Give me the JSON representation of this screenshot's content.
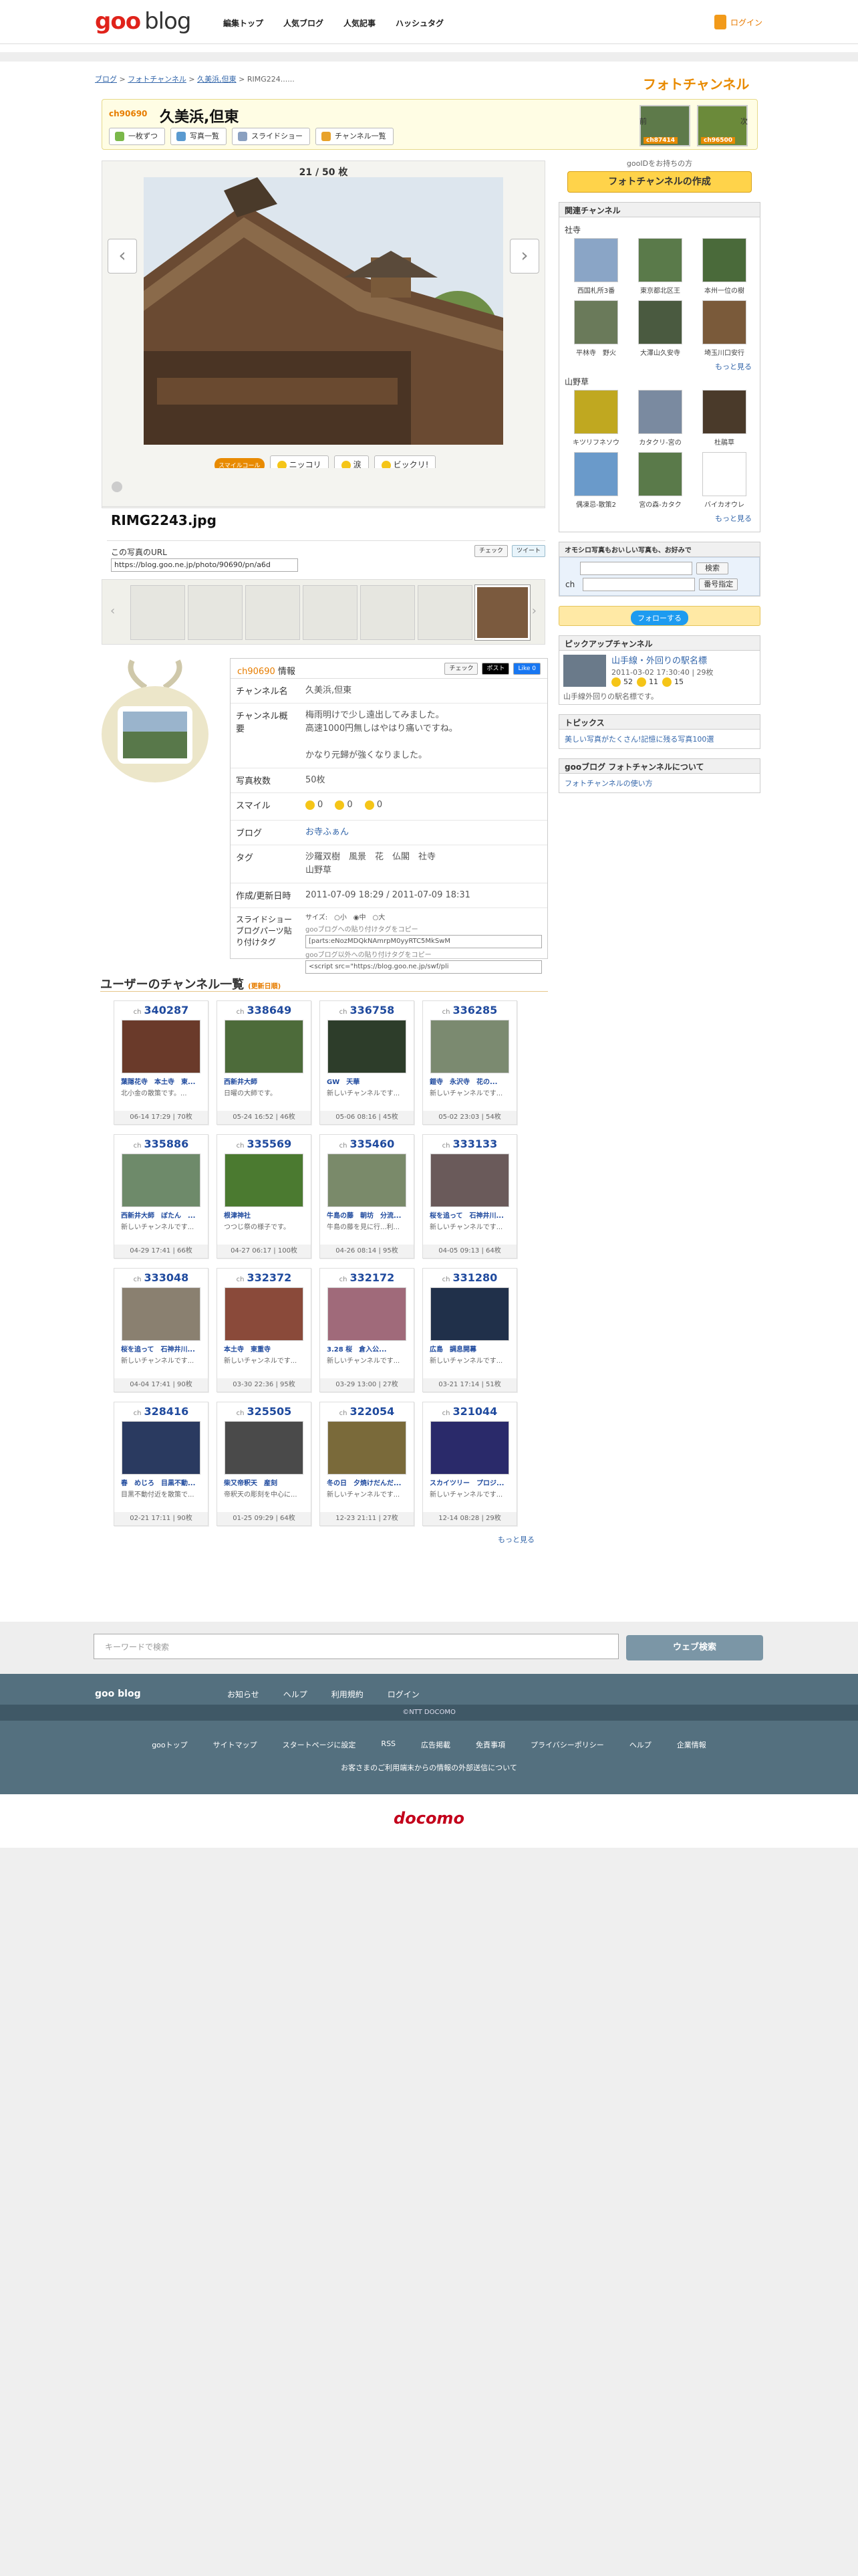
{
  "header": {
    "logo_goo": "goo",
    "logo_blog": "blog",
    "nav": [
      "編集トップ",
      "人気ブログ",
      "人気記事",
      "ハッシュタグ"
    ],
    "login": "ログイン"
  },
  "breadcrumb": [
    "ブログ",
    "フォトチャンネル",
    "久美浜,但東",
    "RIMG224......"
  ],
  "photochannel_logo": "フォトチャンネル",
  "channel": {
    "id": "ch90690",
    "title": "久美浜,但東",
    "buttons": [
      "一枚ずつ",
      "写真一覧",
      "スライドショー",
      "チャンネル一覧"
    ],
    "prev_label": "前",
    "next_label": "次",
    "prev_id": "ch87414",
    "next_id": "ch96500"
  },
  "viewer": {
    "counter": "21 / 50 枚",
    "reactions": [
      "ニッコリ",
      "涙",
      "ビックリ!"
    ],
    "reaction_tag": "スマイルコール",
    "filename": "RIMG2243.jpg",
    "url_label": "この写真のURL",
    "url_value": "https://blog.goo.ne.jp/photo/90690/pn/a6d",
    "check": "チェック",
    "tweet": "ツイート"
  },
  "info": {
    "header": "ch90690 情報",
    "header_id": "ch90690",
    "header_suffix": "情報",
    "post": "ポスト",
    "like": "Like 0",
    "rows": [
      {
        "k": "チャンネル名",
        "v": "久美浜,但東"
      },
      {
        "k": "チャンネル概要",
        "v": "梅雨明けで少し遠出してみました。\n高速1000円無しはやはり痛いですね。\n\nかなり元歸が強くなりました。"
      },
      {
        "k": "写真枚数",
        "v": "50枚"
      },
      {
        "k": "スマイル",
        "v": ""
      },
      {
        "k": "ブログ",
        "v": "お寺ふぁん"
      },
      {
        "k": "タグ",
        "v": "沙羅双樹　風景　花　仏閣　社寺\n山野草"
      },
      {
        "k": "作成/更新日時",
        "v": "2011-07-09 18:29 / 2011-07-09 18:31"
      },
      {
        "k": "スライドショーブログパーツ貼り付けタグ",
        "v": ""
      }
    ],
    "smiles": [
      "0",
      "0",
      "0"
    ],
    "size_label": "サイズ",
    "sizes": [
      "小",
      "中",
      "大"
    ],
    "tag_label1": "gooブログへの貼り付けタグをコピー",
    "tag_value1": "[parts:eNozMDQkNAmrpM0yyRTC5MkSwM",
    "tag_label2": "gooブログ以外への貼り付けタグをコピー",
    "tag_value2": "<script src=\"https://blog.goo.ne.jp/swf/pli"
  },
  "sidebar": {
    "note": "gooIDをお持ちの方",
    "create": "フォトチャンネルの作成",
    "related": "関連チャンネル",
    "groupA": "社寺",
    "groupA_items": [
      "西国札所3番",
      "東京都北区王",
      "本州一位の樹",
      "平林寺　野火",
      "大澤山久安寺",
      "埼玉川口安行"
    ],
    "groupB": "山野草",
    "groupB_items": [
      "キツリフネソウ",
      "カタクリ-宮の",
      "杜鵑草",
      "偶凍忌-散策2",
      "宮の森-カタク",
      "バイカオウレ"
    ],
    "more": "もっと見る",
    "recommend": "オモシロ写真もおいしい写真も、お好みで",
    "search": "検索",
    "number": "番号指定",
    "ch_label": "ch",
    "follow": "フォローする",
    "pickup": "ピックアップチャンネル",
    "pickup_title": "山手線・外回りの駅名標",
    "pickup_date": "2011-03-02 17:30:40 | 29枚",
    "pickup_counts": [
      "52",
      "11",
      "15"
    ],
    "pickup_desc": "山手線外回りの駅名標です。",
    "topics": "トピックス",
    "topics_item": "美しい写真がたくさん!記憶に残る写真100選",
    "about": "gooブログ フォトチャンネルについて",
    "about_item": "フォトチャンネルの使い方"
  },
  "user_channels": {
    "title": "ユーザーのチャンネル一覧",
    "updated": "(更新日順)",
    "more": "もっと見る",
    "items": [
      {
        "id": "340287",
        "t": "葉隠花寺　本土寺　東...",
        "d": "北小金の散策です。...",
        "m": "06-14 17:29 | 70枚",
        "c": "#6a3a2a"
      },
      {
        "id": "338649",
        "t": "西新井大師",
        "d": "日曜の大師です。",
        "m": "05-24 16:52 | 46枚",
        "c": "#4d6b3a"
      },
      {
        "id": "336758",
        "t": "GW　天華",
        "d": "新しいチャンネルです...",
        "m": "05-06 08:16 | 45枚",
        "c": "#2d3d2a"
      },
      {
        "id": "336285",
        "t": "鎧寺　永沢寺　花の...",
        "d": "新しいチャンネルです...",
        "m": "05-02 23:03 | 54枚",
        "c": "#7b8a70"
      },
      {
        "id": "335886",
        "t": "西新井大師　ぼたん　...",
        "d": "新しいチャンネルです...",
        "m": "04-29 17:41 | 66枚",
        "c": "#6e8a6a"
      },
      {
        "id": "335569",
        "t": "根津神社",
        "d": "つつじ祭の様子です。",
        "m": "04-27 06:17 | 100枚",
        "c": "#4b7a30"
      },
      {
        "id": "335460",
        "t": "牛島の藤　朝坊　分流...",
        "d": "牛島の藤を見に行...利...",
        "m": "04-26 08:14 | 95枚",
        "c": "#7a8a6a"
      },
      {
        "id": "333133",
        "t": "桜を追って　石神井川...",
        "d": "新しいチャンネルです...",
        "m": "04-05 09:13 | 64枚",
        "c": "#6a5a5a"
      },
      {
        "id": "333048",
        "t": "桜を追って　石神井川...",
        "d": "新しいチャンネルです...",
        "m": "04-04 17:41 | 90枚",
        "c": "#8a8070"
      },
      {
        "id": "332372",
        "t": "本土寺　東重寺",
        "d": "新しいチャンネルです...",
        "m": "03-30 22:36 | 95枚",
        "c": "#8a4a3a"
      },
      {
        "id": "332172",
        "t": "3.28 桜　倉入公...",
        "d": "新しいチャンネルです...",
        "m": "03-29 13:00 | 27枚",
        "c": "#a06a7a"
      },
      {
        "id": "331280",
        "t": "広島　調息開幕",
        "d": "新しいチャンネルです...",
        "m": "03-21 17:14 | 51枚",
        "c": "#20304a"
      },
      {
        "id": "328416",
        "t": "春　めじろ　目黒不動...",
        "d": "目黒不動付近を散策で...",
        "m": "02-21 17:11 | 90枚",
        "c": "#2a3a60"
      },
      {
        "id": "325505",
        "t": "柴又帝釈天　産刻",
        "d": "帝釈天の彫刻を中心に...",
        "m": "01-25 09:29 | 64枚",
        "c": "#4a4a4a"
      },
      {
        "id": "322054",
        "t": "冬の日　夕焼けだんだ...",
        "d": "新しいチャンネルです...",
        "m": "12-23 21:11 | 27枚",
        "c": "#7a6a3a"
      },
      {
        "id": "321044",
        "t": "スカイツリー　プロジ...",
        "d": "新しいチャンネルです...",
        "m": "12-14 08:28 | 29枚",
        "c": "#2a2a6a"
      }
    ]
  },
  "footer": {
    "search_placeholder": "キーワードで検索",
    "search_button": "ウェブ検索",
    "brand": "goo blog",
    "links": [
      "お知らせ",
      "ヘルプ",
      "利用規約",
      "ログイン"
    ],
    "copyright": "©NTT DOCOMO",
    "links2": [
      "gooトップ",
      "サイトマップ",
      "スタートページに設定",
      "RSS",
      "広告掲載",
      "免責事項",
      "プライバシーポリシー",
      "ヘルプ",
      "企業情報"
    ],
    "notice": "お客さまのご利用端末からの情報の外部送信について",
    "docomo": "docomo"
  }
}
